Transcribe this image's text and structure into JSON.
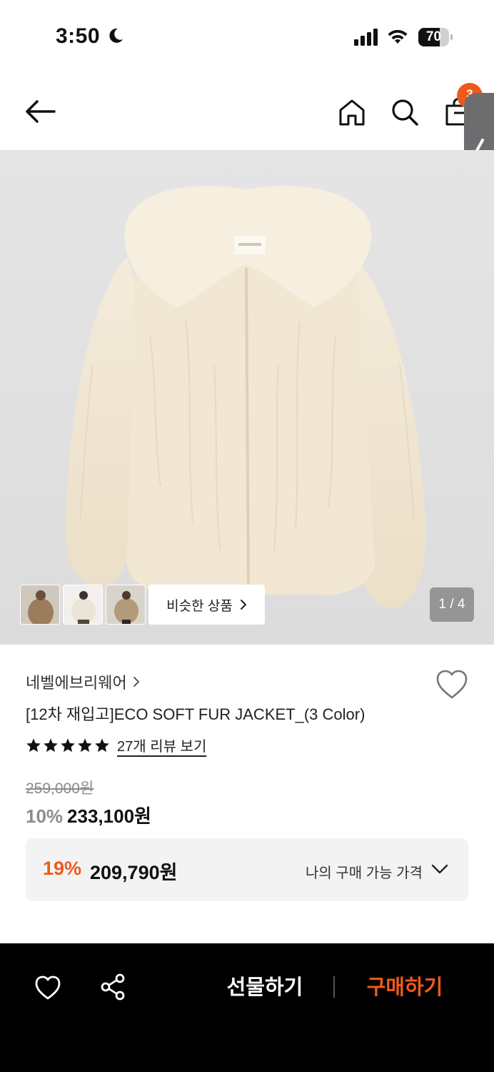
{
  "status_bar": {
    "time": "3:50",
    "battery": "70",
    "battery_level": 0.7
  },
  "top_nav": {
    "cart_count": "3"
  },
  "gallery": {
    "similar_label": "비슷한 상품",
    "page_indicator": "1 / 4",
    "thumbnails": [
      "brown-fur-jacket",
      "white-fur-jacket",
      "beige-fur-jacket"
    ]
  },
  "product": {
    "brand": "네벨에브리웨어",
    "title": "[12차 재입고]ECO SOFT FUR JACKET_(3 Color)",
    "rating_stars": 5,
    "review_link": "27개 리뷰 보기",
    "original_price": "259,000원",
    "discount_rate": "10%",
    "sale_price": "233,100원"
  },
  "my_price": {
    "rate": "19%",
    "price": "209,790원",
    "label": "나의 구매 가능 가격"
  },
  "bottom_bar": {
    "gift_label": "선물하기",
    "buy_label": "구매하기"
  },
  "colors": {
    "accent": "#ef5a1b",
    "bottom_bar": "#000000"
  }
}
